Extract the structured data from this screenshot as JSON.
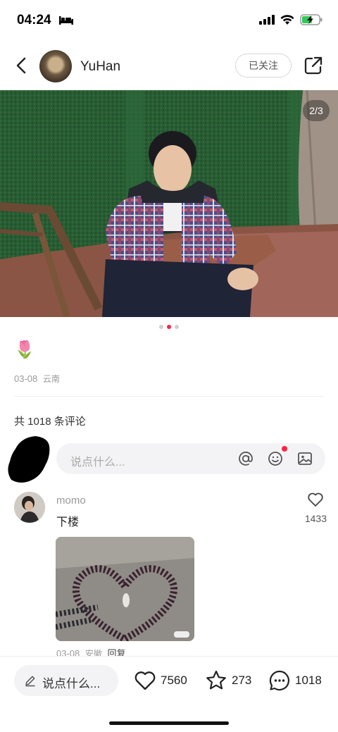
{
  "status_bar": {
    "time": "04:24"
  },
  "header": {
    "author_name": "YuHan",
    "follow_label": "已关注"
  },
  "photo": {
    "counter": "2/3",
    "current_index": 1,
    "total": 3
  },
  "note": {
    "caption": "🌷",
    "date": "03-08",
    "location": "云南"
  },
  "comments": {
    "count_label": "共 1018 条评论",
    "input_placeholder": "说点什么...",
    "items": [
      {
        "user": "momo",
        "text": "下楼",
        "likes": "1433",
        "date": "03-08",
        "location": "安徽",
        "reply_label": "回复"
      }
    ]
  },
  "bottom_bar": {
    "say_label": "说点什么...",
    "likes": "7560",
    "collects": "273",
    "comments": "1018"
  },
  "colors": {
    "accent": "#ff2442",
    "muted": "#999999"
  }
}
